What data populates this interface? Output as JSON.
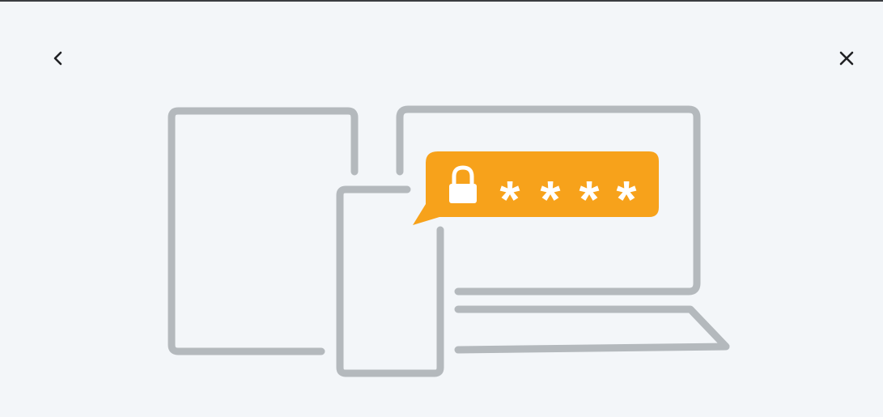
{
  "dialog": {
    "back_icon": "chevron-left-icon",
    "close_icon": "close-icon"
  },
  "illustration": {
    "devices": [
      "tablet",
      "phone",
      "laptop"
    ],
    "badge": {
      "icon": "lock-icon",
      "text": "****",
      "color": "#f7a21b"
    },
    "outline_color": "#b4b9bd",
    "background_color": "#f3f6f9"
  }
}
